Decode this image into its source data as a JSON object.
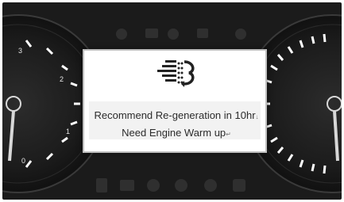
{
  "popup": {
    "icon": "dpf-regeneration-icon",
    "line1": "Recommend Re-generation in 10hr",
    "line1_suffix": "↓",
    "line2": "Need Engine Warm up",
    "line2_suffix": "↵"
  },
  "gauges": {
    "left_tick_labels": [
      "3",
      "2",
      "1",
      "0"
    ]
  },
  "colors": {
    "background": "#1b1b1b",
    "popup_background": "#ffffff",
    "popup_border": "#bfbfbf",
    "gauge_tick": "#ffffff",
    "gauge_needle": "#d8d8d8"
  }
}
